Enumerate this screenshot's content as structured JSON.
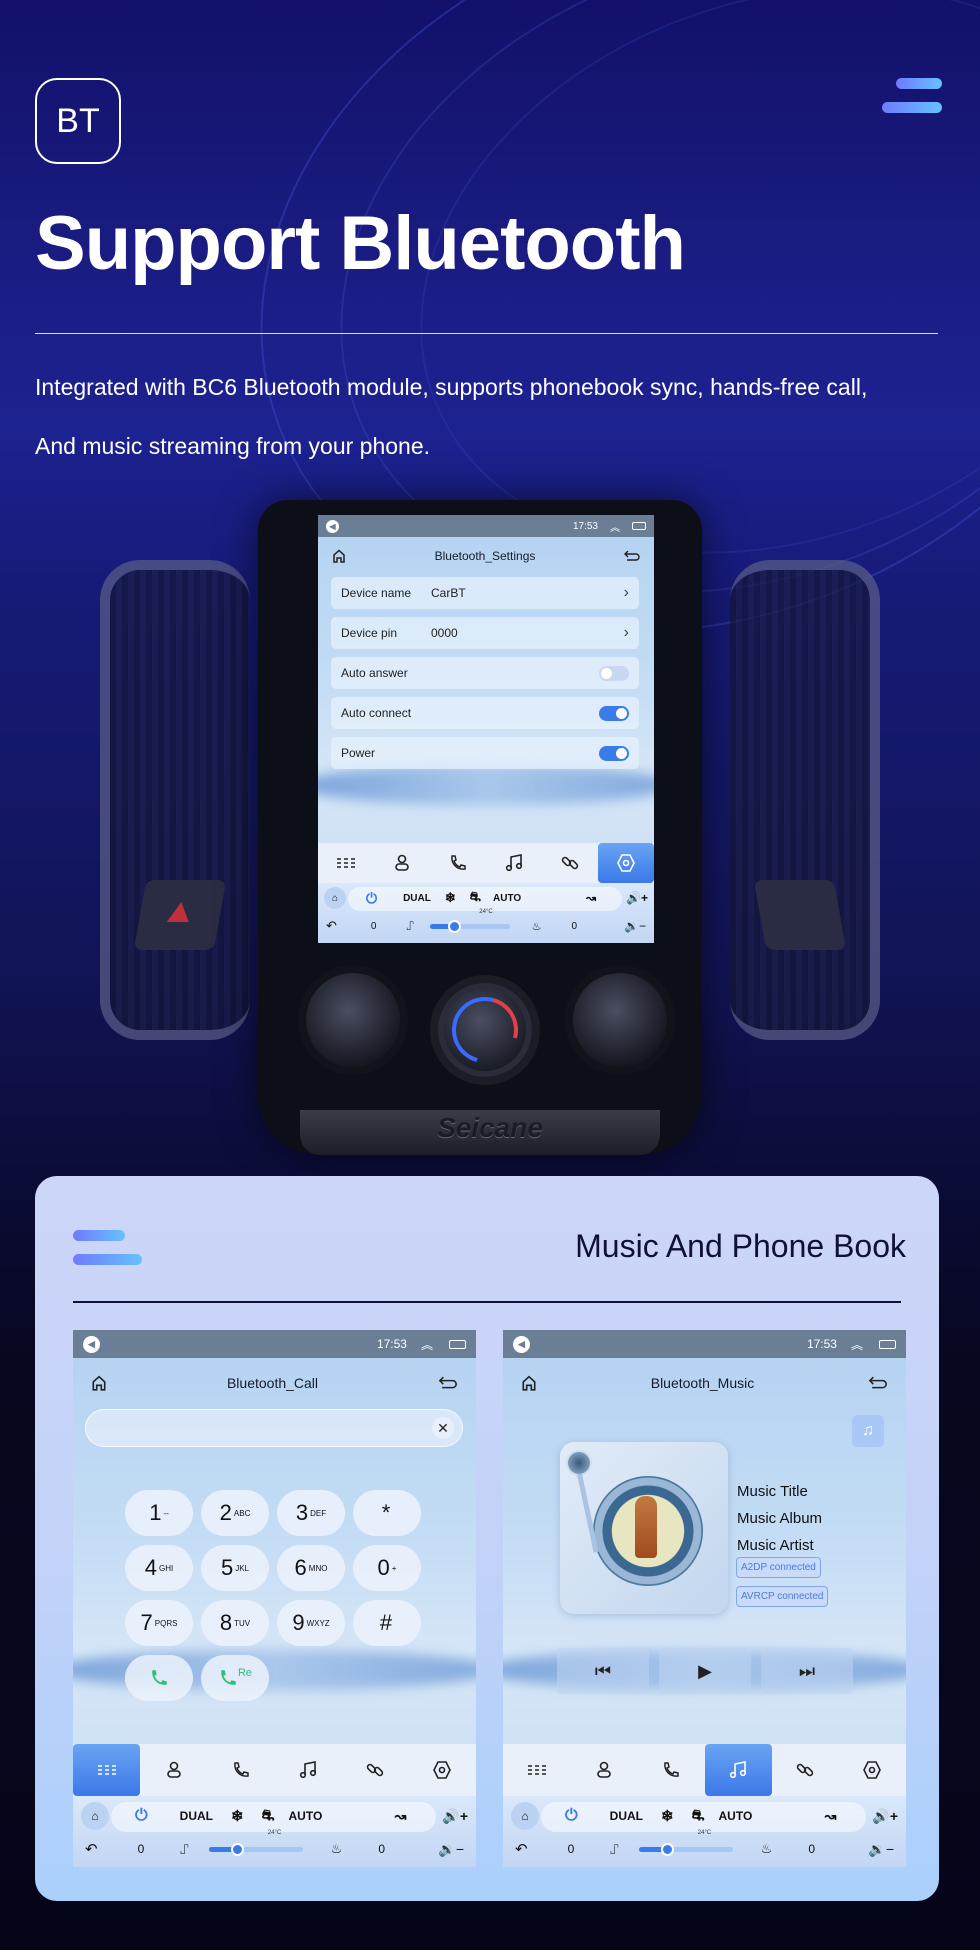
{
  "hero": {
    "badge": "BT",
    "title": "Support Bluetooth",
    "description_lines": [
      "Integrated with BC6 Bluetooth module, supports phonebook sync, hands-free call,",
      "And music streaming from your phone."
    ]
  },
  "status_bar": {
    "time": "17:53"
  },
  "settings_screen": {
    "title": "Bluetooth_Settings",
    "rows": [
      {
        "label": "Device name",
        "value": "CarBT",
        "type": "link"
      },
      {
        "label": "Device pin",
        "value": "0000",
        "type": "link"
      },
      {
        "label": "Auto answer",
        "type": "toggle",
        "on": false
      },
      {
        "label": "Auto connect",
        "type": "toggle",
        "on": true
      },
      {
        "label": "Power",
        "type": "toggle",
        "on": true
      }
    ],
    "active_dock": "settings"
  },
  "dock_items": [
    "dialpad",
    "contacts",
    "call-log",
    "music",
    "link",
    "settings"
  ],
  "climate": {
    "dual": "DUAL",
    "auto": "AUTO",
    "temperature": "24°C",
    "left_seat_value": "0",
    "right_seat_value": "0",
    "fan_level_fraction": 0.3
  },
  "brand": "Seicane",
  "card": {
    "title": "Music And Phone Book"
  },
  "call_screen": {
    "title": "Bluetooth_Call",
    "input_value": "",
    "keys": [
      {
        "n": "1",
        "s": "--"
      },
      {
        "n": "2",
        "s": "ABC"
      },
      {
        "n": "3",
        "s": "DEF"
      },
      {
        "n": "*",
        "s": ""
      },
      {
        "n": "4",
        "s": "GHI"
      },
      {
        "n": "5",
        "s": "JKL"
      },
      {
        "n": "6",
        "s": "MNO"
      },
      {
        "n": "0",
        "s": "+"
      },
      {
        "n": "7",
        "s": "PQRS"
      },
      {
        "n": "8",
        "s": "TUV"
      },
      {
        "n": "9",
        "s": "WXYZ"
      },
      {
        "n": "#",
        "s": ""
      }
    ],
    "redial_label": "Re",
    "active_dock": "dialpad"
  },
  "music_screen": {
    "title": "Bluetooth_Music",
    "track_title": "Music Title",
    "album": "Music Album",
    "artist": "Music Artist",
    "badges": [
      "A2DP  connected",
      "AVRCP connected"
    ],
    "active_dock": "music"
  }
}
